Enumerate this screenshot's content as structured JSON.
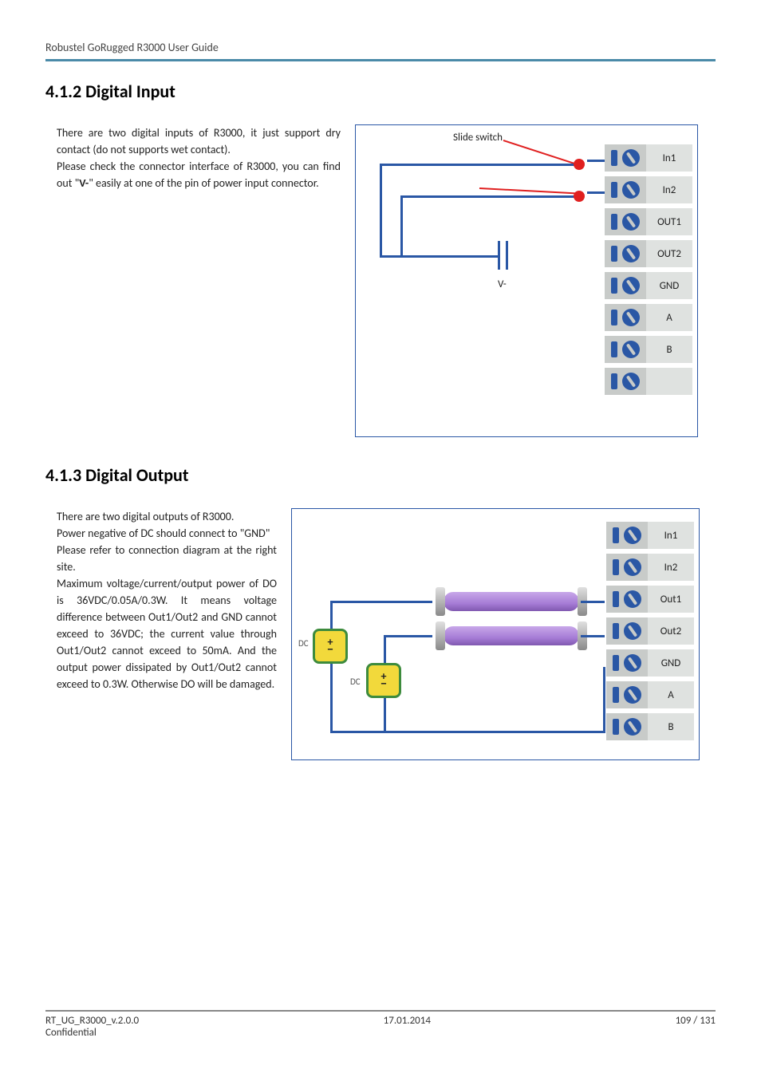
{
  "header": {
    "running": "Robustel GoRugged R3000 User Guide"
  },
  "sections": {
    "s1": {
      "title": "4.1.2 Digital Input",
      "p1": "There are two digital inputs of R3000, it just support dry contact (do not supports wet contact).",
      "p2a": "Please check the connector interface of R3000, you can find out \"",
      "p2bold": "V-",
      "p2b": "\" easily at one of the pin of power input connector."
    },
    "s2": {
      "title": "4.1.3 Digital Output",
      "p1": "There are two digital outputs of R3000.",
      "p2": "Power negative of DC should connect to \"GND\"",
      "p3": "Please refer to connection diagram at the right site.",
      "p4": "Maximum voltage/current/output power of DO is 36VDC/0.05A/0.3W. It means voltage difference between Out1/Out2 and GND cannot exceed to 36VDC; the current value through Out1/Out2 cannot exceed to 50mA. And the output power dissipated by Out1/Out2 cannot exceed to 0.3W. Otherwise DO will be damaged."
    }
  },
  "diagram1": {
    "slide_label": "Slide switch",
    "v_minus": "V-",
    "terminals": [
      "In1",
      "In2",
      "OUT1",
      "OUT2",
      "GND",
      "A",
      "B",
      ""
    ]
  },
  "diagram2": {
    "dc1": "DC",
    "dc2": "DC",
    "terminals": [
      "In1",
      "In2",
      "Out1",
      "Out2",
      "GND",
      "A",
      "B"
    ]
  },
  "footer": {
    "doc": "RT_UG_R3000_v.2.0.0",
    "conf": "Confidential",
    "date": "17.01.2014",
    "page": "109 / 131"
  }
}
